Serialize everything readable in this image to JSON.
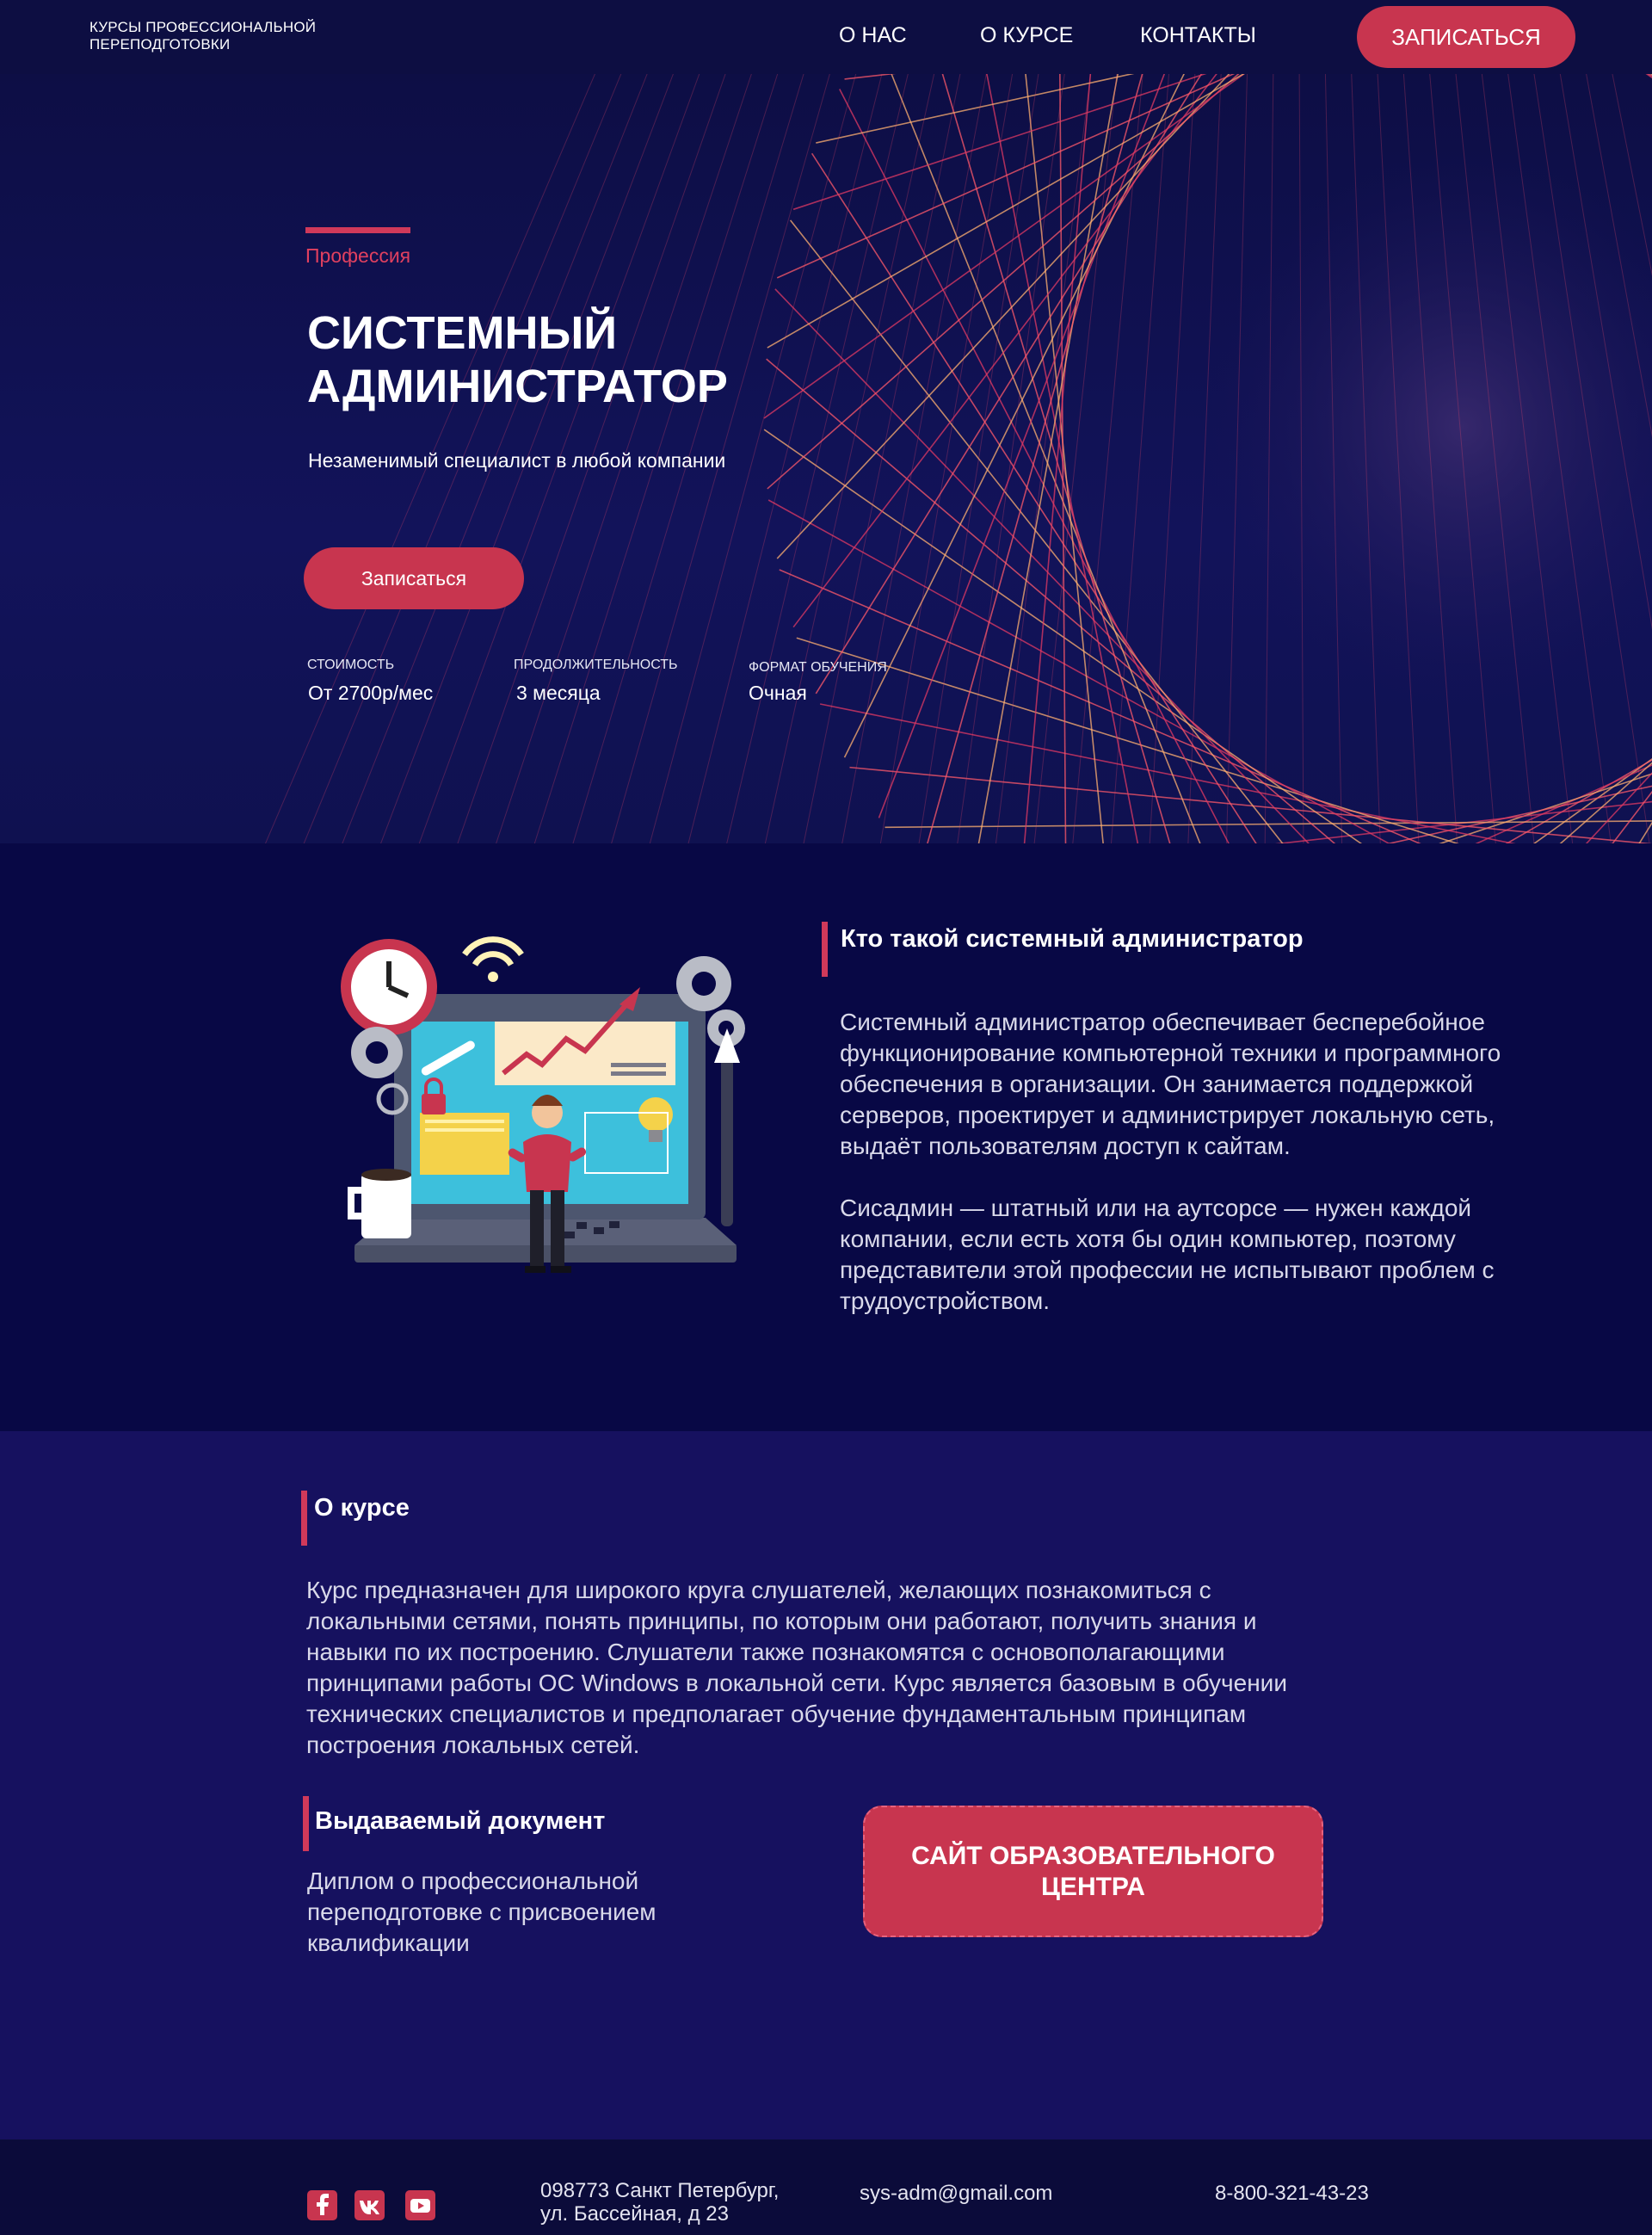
{
  "nav": {
    "brand": "КУРСЫ ПРОФЕССИОНАЛЬНОЙ ПЕРЕПОДГОТОВКИ",
    "links": [
      "О НАС",
      "О КУРСЕ",
      "КОНТАКТЫ"
    ],
    "cta": "ЗАПИСАТЬСЯ"
  },
  "hero": {
    "eyebrow": "Профессия",
    "title": "СИСТЕМНЫЙ АДМИНИСТРАТОР",
    "subtitle": "Незаменимый специалист в любой компании",
    "cta": "Записаться",
    "facts": [
      {
        "label": "СТОИМОСТЬ",
        "value": "От 2700р/мес"
      },
      {
        "label": "ПРОДОЛЖИТЕЛЬНОСТЬ",
        "value": "3 месяца"
      },
      {
        "label": "ФОРМАТ ОБУЧЕНИЯ",
        "value": "Очная"
      }
    ]
  },
  "role": {
    "title": "Кто такой системный администратор",
    "p1": "Системный администратор обеспечивает бесперебойное функционирование компьютерной техники и программного обеспечения в организации. Он занимается поддержкой серверов, проектирует и администрирует локальную сеть, выдаёт пользователям доступ к сайтам.",
    "p2": "Сисадмин — штатный или на аутсорсе — нужен каждой компании, если есть хотя бы один компьютер, поэтому представители этой профессии не испытывают проблем с трудоустройством."
  },
  "course": {
    "title": "О курсе",
    "text": "Курс предназначен для широкого круга слушателей, желающих познакомиться с локальными сетями, понять принципы, по которым они работают, получить знания и навыки по их построению. Слушатели также познакомятся с основополагающими принципами работы ОС Windows в локальной сети. Курс является базовым в обучении технических специалистов  и предполагает обучение фундаментальным принципам  построения локальных сетей.",
    "doc_title": "Выдаваемый документ",
    "doc_text": "Диплом о профессиональной переподготовке с присвоением квалификации",
    "site_button": "САЙТ ОБРАЗОВАТЕЛЬНОГО ЦЕНТРА"
  },
  "footer": {
    "social": [
      "facebook-icon",
      "vk-icon",
      "youtube-icon"
    ],
    "address_line1": "098773 Санкт Петербург,",
    "address_line2": "ул. Бассейная, д 23",
    "email": "sys-adm@gmail.com",
    "phone": "8-800-321-43-23"
  },
  "colors": {
    "accent": "#c8354f",
    "nav_bg": "#0d0e42",
    "role_bg": "#080845",
    "course_bg": "#16115f",
    "footer_bg": "#0b0b3a"
  }
}
